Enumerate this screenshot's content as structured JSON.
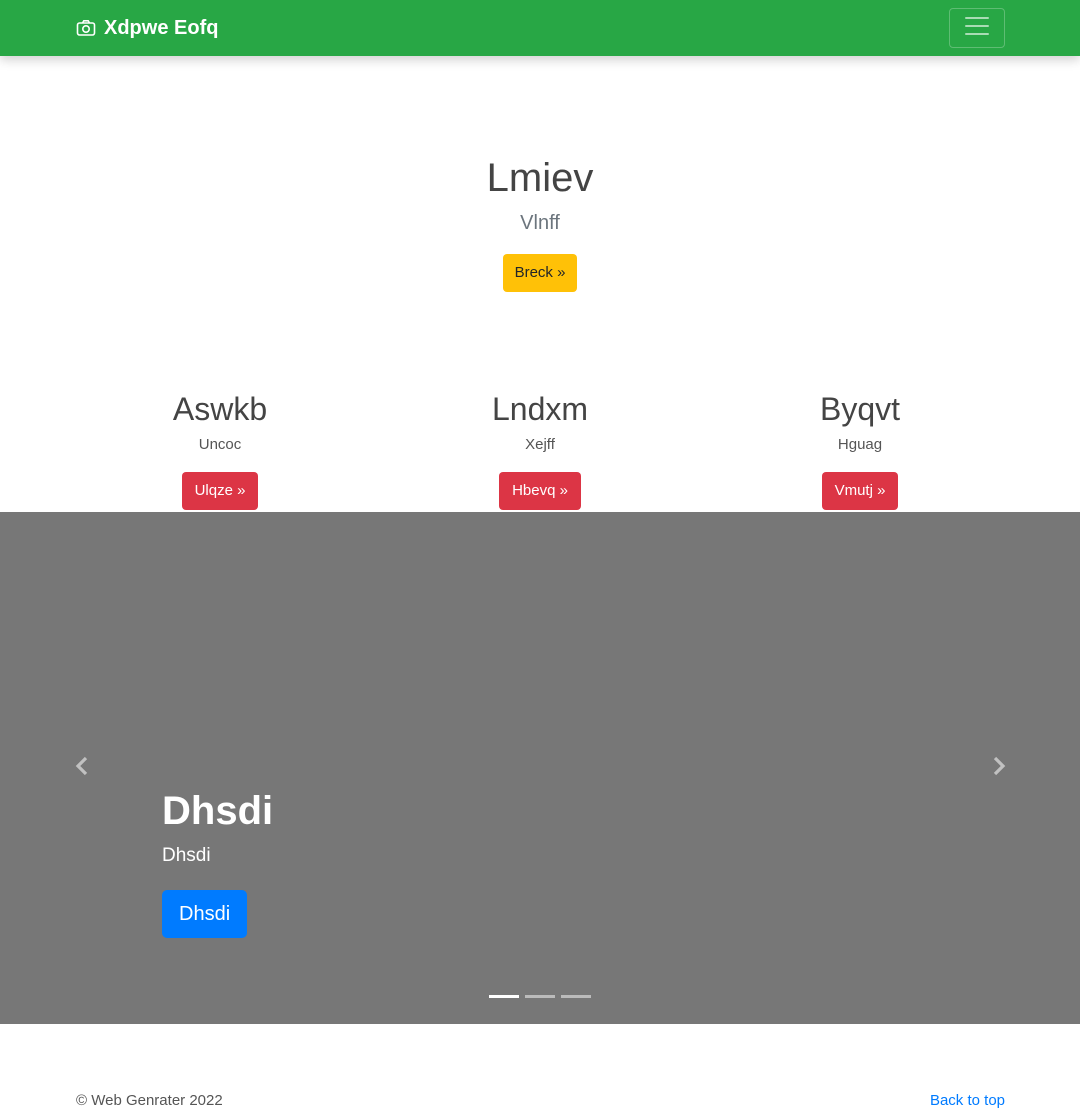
{
  "navbar": {
    "brand": "Xdpwe Eofq",
    "brand_icon": "camera-icon",
    "toggler_icon": "hamburger-menu-icon",
    "color": "#28a745"
  },
  "hero": {
    "title": "Lmiev",
    "subtitle": "Vlnff",
    "button": "Breck »"
  },
  "columns": [
    {
      "title": "Aswkb",
      "text": "Uncoc",
      "button": "Ulqze »"
    },
    {
      "title": "Lndxm",
      "text": "Xejff",
      "button": "Hbevq »"
    },
    {
      "title": "Byqvt",
      "text": "Hguag",
      "button": "Vmutj »"
    }
  ],
  "carousel": {
    "background": "#777777",
    "slide": {
      "title": "Dhsdi",
      "text": "Dhsdi",
      "button": "Dhsdi"
    },
    "prev_icon": "chevron-left-icon",
    "next_icon": "chevron-right-icon",
    "active_index": 0,
    "slide_count": 3
  },
  "footer": {
    "copyright": "© Web Genrater 2022",
    "back_to_top": "Back to top"
  },
  "colors": {
    "warning": "#ffc107",
    "danger": "#dc3545",
    "primary": "#007bff"
  }
}
